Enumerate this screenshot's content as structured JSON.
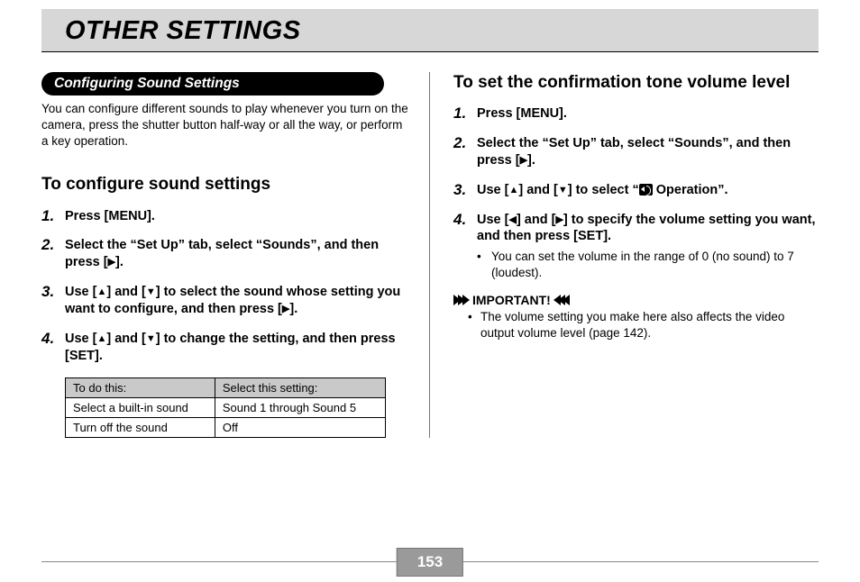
{
  "page_title": "OTHER SETTINGS",
  "page_number": "153",
  "left": {
    "section_pill": "Configuring Sound Settings",
    "intro": "You can configure different sounds to play whenever you turn on the camera, press the shutter button half-way or all the way, or perform a key operation.",
    "heading": "To configure sound settings",
    "steps": {
      "s1": "Press [MENU].",
      "s2a": "Select the “Set Up” tab, select “Sounds”, and then press [",
      "s2b": "].",
      "s3a": "Use [",
      "s3b": "] and [",
      "s3c": "] to select the sound whose setting you want to configure, and then press [",
      "s3d": "].",
      "s4a": "Use [",
      "s4b": "] and [",
      "s4c": "] to change the setting, and then press [SET]."
    },
    "table": {
      "h1": "To do this:",
      "h2": "Select this setting:",
      "r1c1": "Select a built-in sound",
      "r1c2": "Sound 1 through Sound 5",
      "r2c1": "Turn off the sound",
      "r2c2": "Off"
    }
  },
  "right": {
    "heading": "To set the confirmation tone volume level",
    "steps": {
      "s1": "Press [MENU].",
      "s2a": "Select the “Set Up” tab, select “Sounds”, and then press [",
      "s2b": "].",
      "s3a": "Use [",
      "s3b": "] and [",
      "s3c": "] to select “",
      "s3d": " Operation”.",
      "s4a": "Use [",
      "s4b": "] and [",
      "s4c": "] to specify the volume setting you want, and then press [SET].",
      "s4_sub": "You can set the volume in the range of 0 (no sound) to 7 (loudest)."
    },
    "important_label": "IMPORTANT!",
    "important_body": "The volume setting you make here also affects the video output volume level (page 142)."
  }
}
